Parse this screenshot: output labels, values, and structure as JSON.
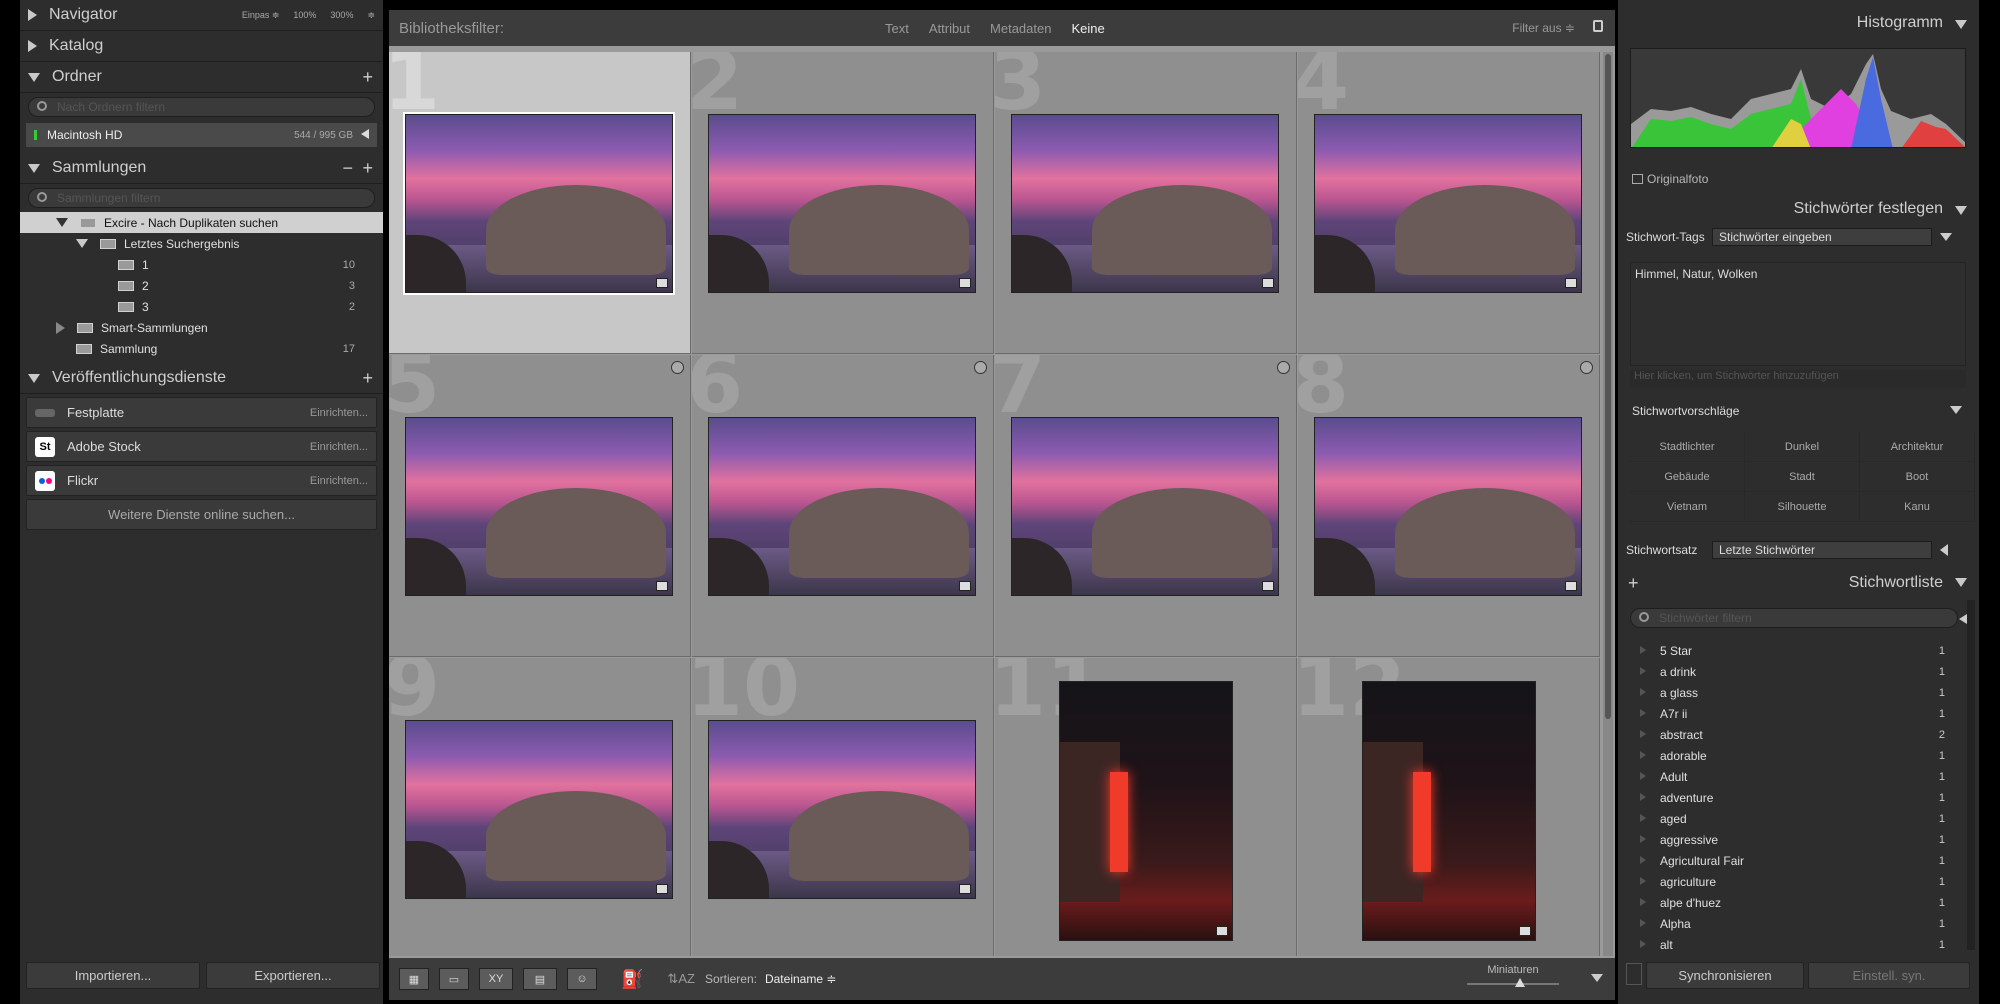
{
  "left": {
    "navigator": {
      "title": "Navigator",
      "zoom": [
        "Einpas ≑",
        "100%",
        "300%",
        "≑"
      ]
    },
    "katalog": {
      "title": "Katalog"
    },
    "ordner": {
      "title": "Ordner",
      "search_placeholder": "Nach Ordnern filtern",
      "volume": {
        "name": "Macintosh HD",
        "size": "544 / 995 GB"
      }
    },
    "sammlungen": {
      "title": "Sammlungen",
      "search_placeholder": "Sammlungen filtern",
      "items": [
        {
          "label": "Excire - Nach Duplikaten suchen",
          "count": ""
        },
        {
          "label": "Letztes Suchergebnis",
          "count": ""
        },
        {
          "label": "1",
          "count": "10"
        },
        {
          "label": "2",
          "count": "3"
        },
        {
          "label": "3",
          "count": "2"
        },
        {
          "label": "Smart-Sammlungen",
          "count": ""
        },
        {
          "label": "Sammlung",
          "count": "17"
        }
      ]
    },
    "dienste": {
      "title": "Veröffentlichungsdienste",
      "items": [
        {
          "label": "Festplatte",
          "action": "Einrichten..."
        },
        {
          "label": "Adobe Stock",
          "action": "Einrichten..."
        },
        {
          "label": "Flickr",
          "action": "Einrichten..."
        }
      ],
      "more": "Weitere Dienste online suchen..."
    },
    "import_label": "Importieren...",
    "export_label": "Exportieren..."
  },
  "filterbar": {
    "label": "Bibliotheksfilter:",
    "tabs": [
      "Text",
      "Attribut",
      "Metadaten",
      "Keine"
    ],
    "status": "Filter aus ≑"
  },
  "grid": {
    "numbers": [
      "1",
      "2",
      "3",
      "4",
      "5",
      "6",
      "7",
      "8",
      "9",
      "10",
      "11",
      "12"
    ]
  },
  "toolbar": {
    "sort_label": "Sortieren:",
    "sort_value": "Dateiname ≑",
    "thumb_label": "Miniaturen"
  },
  "right": {
    "histogram": {
      "title": "Histogramm",
      "original": "Originalfoto"
    },
    "keywording": {
      "title": "Stichwörter festlegen",
      "tags_label": "Stichwort-Tags",
      "tags_select": "Stichwörter eingeben",
      "keywords": "Himmel, Natur, Wolken",
      "add_placeholder": "Hier klicken, um Stichwörter hinzuzufügen",
      "suggestions_title": "Stichwortvorschläge",
      "suggestions": [
        "Stadtlichter",
        "Dunkel",
        "Architektur",
        "Gebäude",
        "Stadt",
        "Boot",
        "Vietnam",
        "Silhouette",
        "Kanu"
      ],
      "set_label": "Stichwortsatz",
      "set_value": "Letzte Stichwörter"
    },
    "keywordlist": {
      "title": "Stichwortliste",
      "search_placeholder": "Stichwörter filtern",
      "items": [
        {
          "label": "5 Star",
          "count": "1"
        },
        {
          "label": "a drink",
          "count": "1"
        },
        {
          "label": "a glass",
          "count": "1"
        },
        {
          "label": "A7r ii",
          "count": "1"
        },
        {
          "label": "abstract",
          "count": "2"
        },
        {
          "label": "adorable",
          "count": "1"
        },
        {
          "label": "Adult",
          "count": "1"
        },
        {
          "label": "adventure",
          "count": "1"
        },
        {
          "label": "aged",
          "count": "1"
        },
        {
          "label": "aggressive",
          "count": "1"
        },
        {
          "label": "Agricultural Fair",
          "count": "1"
        },
        {
          "label": "agriculture",
          "count": "1"
        },
        {
          "label": "alpe d'huez",
          "count": "1"
        },
        {
          "label": "Alpha",
          "count": "1"
        },
        {
          "label": "alt",
          "count": "1"
        }
      ]
    },
    "sync_label": "Synchronisieren",
    "settings_label": "Einstell. syn."
  }
}
